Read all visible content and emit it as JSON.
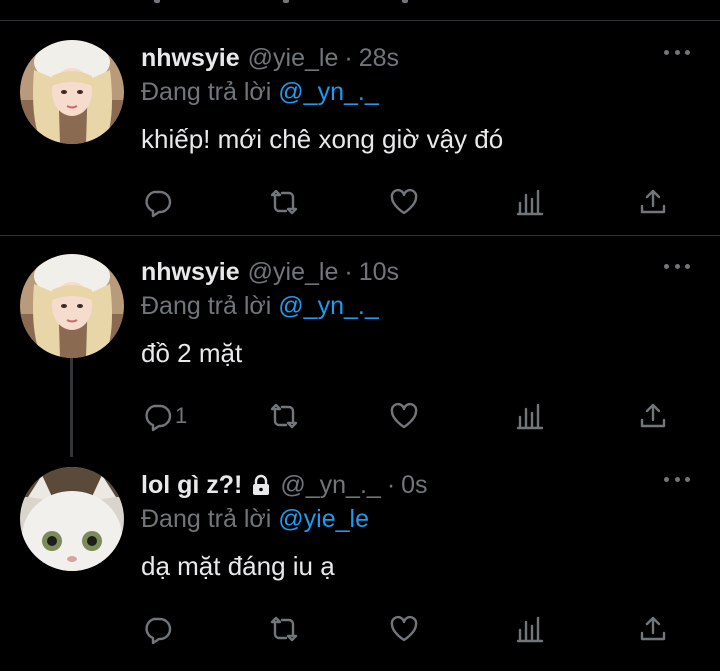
{
  "colors": {
    "background": "#000000",
    "text": "#e7e9ea",
    "muted": "#71767b",
    "accent": "#1d9bf0",
    "divider": "#2f3336"
  },
  "tweets": [
    {
      "name": "nhwsyie",
      "handle": "@yie_le",
      "separator": "·",
      "time": "28s",
      "reply_prefix": "Đang trả lời ",
      "reply_to": "@_yn_._",
      "text": "khiếp! mới chê xong giờ vậy đó",
      "reply_count": "",
      "avatar": "blonde-girl-avatar",
      "locked": false
    },
    {
      "name": "nhwsyie",
      "handle": "@yie_le",
      "separator": "·",
      "time": "10s",
      "reply_prefix": "Đang trả lời ",
      "reply_to": "@_yn_._",
      "text": "đồ 2 mặt",
      "reply_count": "1",
      "avatar": "blonde-girl-avatar",
      "locked": false
    },
    {
      "name": "lol gì z?!",
      "handle": "@_yn_._",
      "separator": "·",
      "time": "0s",
      "reply_prefix": "Đang trả lời ",
      "reply_to": "@yie_le",
      "text": "dạ mặt đáng iu ạ",
      "reply_count": "",
      "avatar": "white-cat-avatar",
      "locked": true
    }
  ],
  "action_icons": [
    "reply-icon",
    "retweet-icon",
    "like-icon",
    "analytics-icon",
    "share-icon"
  ]
}
